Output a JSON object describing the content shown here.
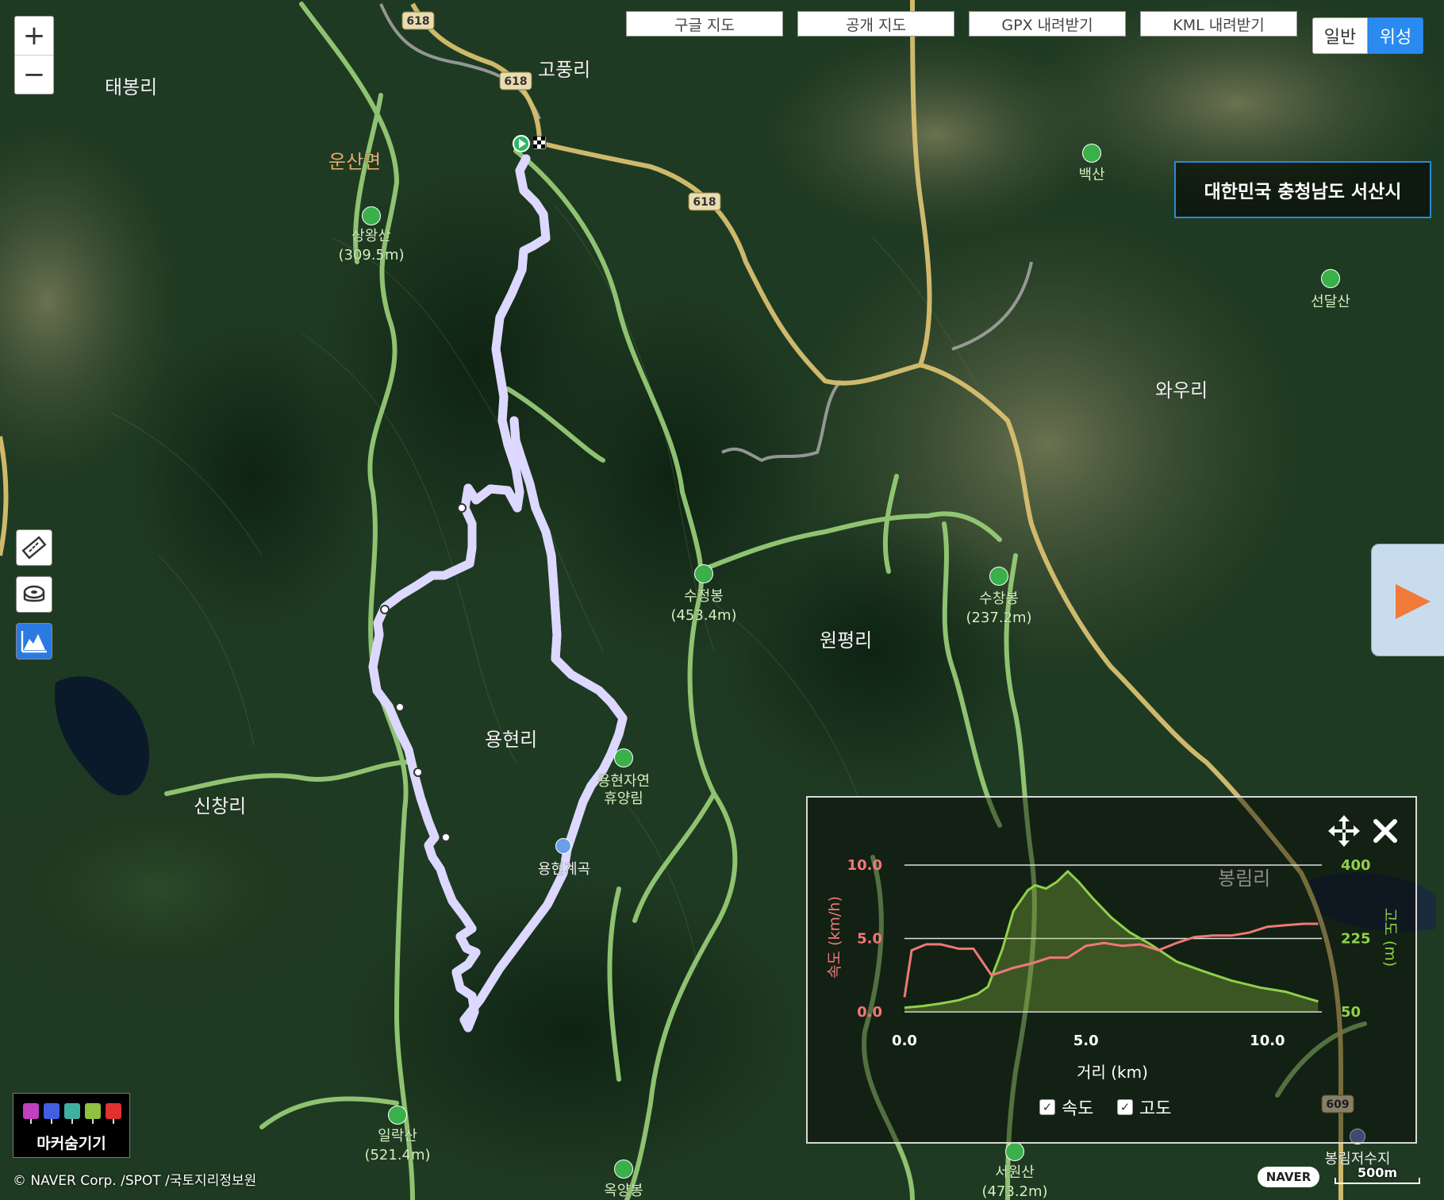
{
  "top_buttons": {
    "google_map": "구글 지도",
    "open_map": "공개 지도",
    "gpx_download": "GPX 내려받기",
    "kml_download": "KML 내려받기"
  },
  "map_type": {
    "normal": "일반",
    "satellite": "위성",
    "selected": "위성"
  },
  "zoom": {
    "in": "+",
    "out": "−"
  },
  "region": "대한민국 충청남도 서산시",
  "place_labels": {
    "gopungri": "고풍리",
    "taebongri": "태봉리",
    "unsanmyeon": "운산면",
    "waori": "와우리",
    "wonpyeongri": "원평리",
    "yonghyeonri": "용현리",
    "sinchangri": "신창리",
    "bongnimri": "봉림리"
  },
  "peaks": {
    "sangwangsan": "상왕산",
    "sangwangsan_elev": "(309.5m)",
    "baeksan": "백산",
    "seondalsan": "선달산",
    "sujeongbong": "수정봉",
    "sujeongbong_elev": "(453.4m)",
    "suchangbong": "수창봉",
    "suchangbong_elev": "(237.2m)",
    "illaksan": "일락산",
    "illaksan_elev": "(521.4m)",
    "seowonsan": "서원산",
    "seowonsan_elev": "(473.2m)",
    "okyangbong": "옥양봉",
    "forest_line1": "용현자연",
    "forest_line2": "휴양림",
    "valley": "용현계곡",
    "reservoir": "봉림저수지"
  },
  "road_numbers": {
    "r618": "618",
    "r609": "609"
  },
  "colors": {
    "route": "#7b78f0",
    "speed": "#f07878",
    "elevation": "#8fd14a",
    "accent": "#2a7ae2"
  },
  "elevation_chart": {
    "x_label": "거리 (km)",
    "y_left_label": "속도 (km/h)",
    "y_right_label": "고도 (m)",
    "x_ticks": [
      "0.0",
      "5.0",
      "10.0"
    ],
    "y_left_ticks": [
      "0.0",
      "5.0",
      "10.0"
    ],
    "y_right_ticks": [
      "50",
      "225",
      "400"
    ],
    "legend_speed": "속도",
    "legend_elevation": "고도"
  },
  "chart_data": {
    "type": "area",
    "xlim": [
      0,
      11.5
    ],
    "y_left_lim": [
      0,
      10
    ],
    "y_right_lim": [
      50,
      400
    ],
    "grid": true,
    "series": [
      {
        "name": "속도",
        "axis": "left",
        "x": [
          0,
          0.2,
          0.6,
          1.0,
          1.5,
          1.9,
          2.4,
          3.0,
          3.5,
          4.0,
          4.5,
          5.0,
          5.5,
          6.0,
          6.5,
          7.0,
          7.5,
          8.0,
          8.5,
          9.0,
          9.5,
          10.0,
          10.5,
          11.0,
          11.4
        ],
        "values": [
          1.0,
          4.2,
          4.6,
          4.6,
          4.3,
          4.3,
          2.5,
          3.0,
          3.3,
          3.7,
          3.7,
          4.5,
          4.7,
          4.5,
          4.6,
          4.2,
          4.7,
          5.1,
          5.2,
          5.2,
          5.4,
          5.8,
          5.9,
          6.0,
          6.0
        ]
      },
      {
        "name": "고도",
        "axis": "right",
        "x": [
          0,
          0.5,
          1.0,
          1.5,
          2.0,
          2.3,
          2.7,
          3.0,
          3.4,
          3.6,
          3.9,
          4.2,
          4.5,
          4.8,
          5.2,
          5.7,
          6.2,
          6.8,
          7.5,
          8.2,
          9.0,
          9.8,
          10.5,
          11.0,
          11.4
        ],
        "values": [
          60,
          64,
          70,
          78,
          92,
          110,
          200,
          290,
          340,
          352,
          344,
          360,
          385,
          360,
          320,
          275,
          240,
          210,
          170,
          148,
          125,
          108,
          98,
          85,
          75
        ]
      }
    ]
  },
  "marker_hide": "마커숨기기",
  "attribution": "© NAVER Corp. /SPOT /국토지리정보원",
  "scale": "500m",
  "naver_logo": "NAVER"
}
